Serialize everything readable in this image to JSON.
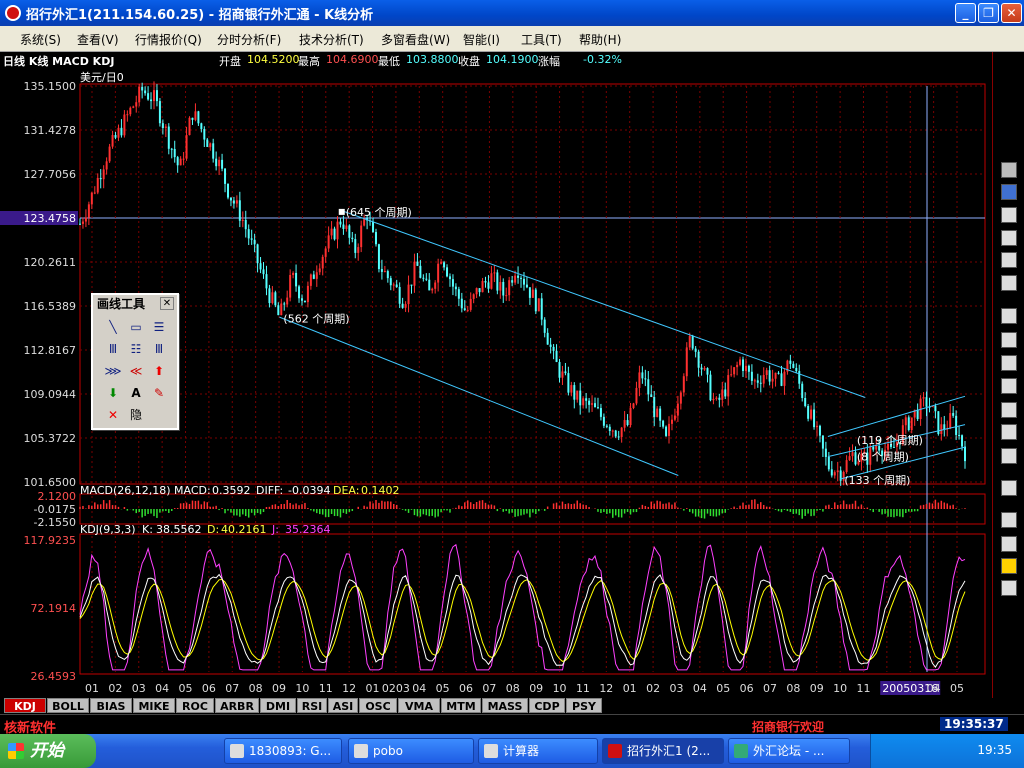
{
  "window": {
    "title": "招行外汇1(211.154.60.25) - 招商银行外汇通 - K线分析",
    "minimize": "_",
    "maximize": "❐",
    "close": "✕"
  },
  "menu": [
    {
      "label": "系统(S)"
    },
    {
      "label": "查看(V)"
    },
    {
      "label": "行情报价(Q)"
    },
    {
      "label": "分时分析(F)"
    },
    {
      "label": "技术分析(T)"
    },
    {
      "label": "多窗看盘(W)"
    },
    {
      "label": "智能(I)"
    },
    {
      "label": "工具(T)"
    },
    {
      "label": "帮助(H)"
    }
  ],
  "chart_header": {
    "panel_label": "日线 K线 MACD KDJ",
    "open_label": "开盘",
    "open": "104.5200",
    "high_label": "最高",
    "high": "104.6900",
    "low_label": "最低",
    "low": "103.8800",
    "close_label": "收盘",
    "close": "104.1900",
    "change_label": "涨幅",
    "change": "-0.32%",
    "symbol": "美元/日0"
  },
  "colors": {
    "up": "#ff3030",
    "down": "#54ffff",
    "grid": "#7a0000",
    "axis": "#c00000",
    "trend": "#40c8ff",
    "kline_k": "#ffffff",
    "kline_d": "#ffff00",
    "kline_j": "#ff40ff"
  },
  "chart_data": [
    {
      "type": "candlestick",
      "name": "main",
      "ylim": [
        101.65,
        135.15
      ],
      "yticks": [
        "135.1500",
        "131.4278",
        "127.7056",
        "123.4758",
        "120.2611",
        "116.5389",
        "112.8167",
        "109.0944",
        "105.3722",
        "101.6500"
      ],
      "highlight_price": "123.4758",
      "x_labels": [
        "01",
        "02",
        "03",
        "04",
        "05",
        "06",
        "07",
        "08",
        "09",
        "10",
        "11",
        "12",
        "01",
        "0203",
        "04",
        "05",
        "06",
        "07",
        "08",
        "09",
        "10",
        "11",
        "12",
        "01",
        "02",
        "03",
        "04",
        "05",
        "06",
        "07",
        "08",
        "09",
        "10",
        "11",
        "12",
        "20050316",
        "04",
        "05"
      ],
      "highlighted_date": "20050316",
      "path_points": [
        {
          "t": 0,
          "v": 123.5
        },
        {
          "t": 1,
          "v": 126
        },
        {
          "t": 2,
          "v": 129
        },
        {
          "t": 3,
          "v": 131
        },
        {
          "t": 4,
          "v": 133
        },
        {
          "t": 5,
          "v": 134.8
        },
        {
          "t": 6,
          "v": 134
        },
        {
          "t": 7,
          "v": 131
        },
        {
          "t": 8,
          "v": 128
        },
        {
          "t": 9,
          "v": 133
        },
        {
          "t": 10,
          "v": 131
        },
        {
          "t": 11,
          "v": 129
        },
        {
          "t": 12,
          "v": 126
        },
        {
          "t": 13,
          "v": 124
        },
        {
          "t": 14,
          "v": 121
        },
        {
          "t": 15,
          "v": 118
        },
        {
          "t": 16,
          "v": 115.5
        },
        {
          "t": 17,
          "v": 119
        },
        {
          "t": 18,
          "v": 117
        },
        {
          "t": 19,
          "v": 120
        },
        {
          "t": 20,
          "v": 122
        },
        {
          "t": 21,
          "v": 124
        },
        {
          "t": 22,
          "v": 121
        },
        {
          "t": 23,
          "v": 124.5
        },
        {
          "t": 24,
          "v": 120
        },
        {
          "t": 25,
          "v": 118.5
        },
        {
          "t": 26,
          "v": 117
        },
        {
          "t": 27,
          "v": 120
        },
        {
          "t": 28,
          "v": 117.5
        },
        {
          "t": 29,
          "v": 121
        },
        {
          "t": 30,
          "v": 118
        },
        {
          "t": 31,
          "v": 116
        },
        {
          "t": 32,
          "v": 118
        },
        {
          "t": 33,
          "v": 119
        },
        {
          "t": 34,
          "v": 117.5
        },
        {
          "t": 35,
          "v": 120
        },
        {
          "t": 36,
          "v": 118
        },
        {
          "t": 37,
          "v": 116
        },
        {
          "t": 38,
          "v": 112
        },
        {
          "t": 39,
          "v": 110
        },
        {
          "t": 40,
          "v": 108.5
        },
        {
          "t": 41,
          "v": 108
        },
        {
          "t": 42,
          "v": 107
        },
        {
          "t": 43,
          "v": 106
        },
        {
          "t": 44,
          "v": 106.5
        },
        {
          "t": 45,
          "v": 111
        },
        {
          "t": 46,
          "v": 108
        },
        {
          "t": 47,
          "v": 105
        },
        {
          "t": 48,
          "v": 109
        },
        {
          "t": 49,
          "v": 114
        },
        {
          "t": 50,
          "v": 111
        },
        {
          "t": 51,
          "v": 108
        },
        {
          "t": 52,
          "v": 110
        },
        {
          "t": 53,
          "v": 112
        },
        {
          "t": 54,
          "v": 110
        },
        {
          "t": 55,
          "v": 111
        },
        {
          "t": 56,
          "v": 110
        },
        {
          "t": 57,
          "v": 112
        },
        {
          "t": 58,
          "v": 109
        },
        {
          "t": 59,
          "v": 106
        },
        {
          "t": 60,
          "v": 103
        },
        {
          "t": 61,
          "v": 102.5
        },
        {
          "t": 62,
          "v": 104
        },
        {
          "t": 63,
          "v": 103.5
        },
        {
          "t": 64,
          "v": 105
        },
        {
          "t": 65,
          "v": 104
        },
        {
          "t": 66,
          "v": 106
        },
        {
          "t": 67,
          "v": 107.5
        },
        {
          "t": 68,
          "v": 108.5
        },
        {
          "t": 69,
          "v": 106
        },
        {
          "t": 70,
          "v": 107
        },
        {
          "t": 71,
          "v": 104.2
        }
      ],
      "annotations": [
        {
          "text": "(645 个周期)",
          "at_t": 21,
          "at_v": 124.5
        },
        {
          "text": "(562 个周期)",
          "at_t": 16,
          "at_v": 115.5
        },
        {
          "text": "(119 个周期)",
          "at_t": 62,
          "at_v": 105.2
        },
        {
          "text": "(8 个周期)",
          "at_t": 62,
          "at_v": 103.8
        },
        {
          "text": "(133 个周期)",
          "at_t": 61,
          "at_v": 101.8
        }
      ]
    },
    {
      "type": "bar",
      "name": "MACD",
      "header": "MACD(26,12,18)",
      "macd_label": "MACD:",
      "macd": "0.3592",
      "diff_label": "DIFF:",
      "diff": "-0.0394",
      "dea_label": "DEA:",
      "dea": "0.1402",
      "yticks": [
        "2.1200",
        "-0.0175",
        "-2.1550"
      ],
      "ylim": [
        -2.155,
        2.12
      ]
    },
    {
      "type": "line",
      "name": "KDJ",
      "header": "KDJ(9,3,3)",
      "k_label": "K:",
      "k": "38.5562",
      "d_label": "D:",
      "d": "40.2161",
      "j_label": "J:",
      "j": "35.2364",
      "yticks": [
        "117.9235",
        "72.1914",
        "26.4593"
      ],
      "ylim": [
        0,
        130
      ]
    }
  ],
  "palette": {
    "title": "画线工具",
    "close": "✕",
    "icons": [
      {
        "name": "line-tool-icon",
        "glyph": "╲"
      },
      {
        "name": "rect-tool-icon",
        "glyph": "▭"
      },
      {
        "name": "parallel-tool-icon",
        "glyph": "☰"
      },
      {
        "name": "fibo-tool-icon",
        "glyph": "Ⅲ"
      },
      {
        "name": "gann-tool-icon",
        "glyph": "☷"
      },
      {
        "name": "cycle-tool-icon",
        "glyph": "Ⅲ"
      },
      {
        "name": "speed-tool-icon",
        "glyph": "⋙"
      },
      {
        "name": "fan-tool-icon",
        "glyph": "≪"
      },
      {
        "name": "up-arrow-icon",
        "glyph": "⬆"
      },
      {
        "name": "down-arrow-icon",
        "glyph": "⬇"
      },
      {
        "name": "text-tool-icon",
        "glyph": "A"
      },
      {
        "name": "eraser-icon",
        "glyph": "✎"
      },
      {
        "name": "delete-icon",
        "glyph": "✕"
      },
      {
        "name": "hide-icon",
        "glyph": "隐"
      }
    ]
  },
  "tabs": [
    {
      "label": "KDJ",
      "active": true
    },
    {
      "label": "BOLL"
    },
    {
      "label": "BIAS"
    },
    {
      "label": "MIKE"
    },
    {
      "label": "ROC"
    },
    {
      "label": "ARBR"
    },
    {
      "label": "DMI"
    },
    {
      "label": "RSI"
    },
    {
      "label": "ASI"
    },
    {
      "label": "OSC"
    },
    {
      "label": "VMA"
    },
    {
      "label": "MTM"
    },
    {
      "label": "MASS"
    },
    {
      "label": "CDP"
    },
    {
      "label": "PSY"
    }
  ],
  "status": {
    "brand": "核新软件",
    "marquee": "招商银行欢迎",
    "time": "19:35:37"
  },
  "taskbar": {
    "start": "开始",
    "tasks": [
      {
        "label": "1830893: G..."
      },
      {
        "label": "pobo"
      },
      {
        "label": "计算器"
      },
      {
        "label": "招行外汇1 (2...",
        "active": true
      },
      {
        "label": "外汇论坛 - ..."
      }
    ],
    "clock": "19:35"
  }
}
